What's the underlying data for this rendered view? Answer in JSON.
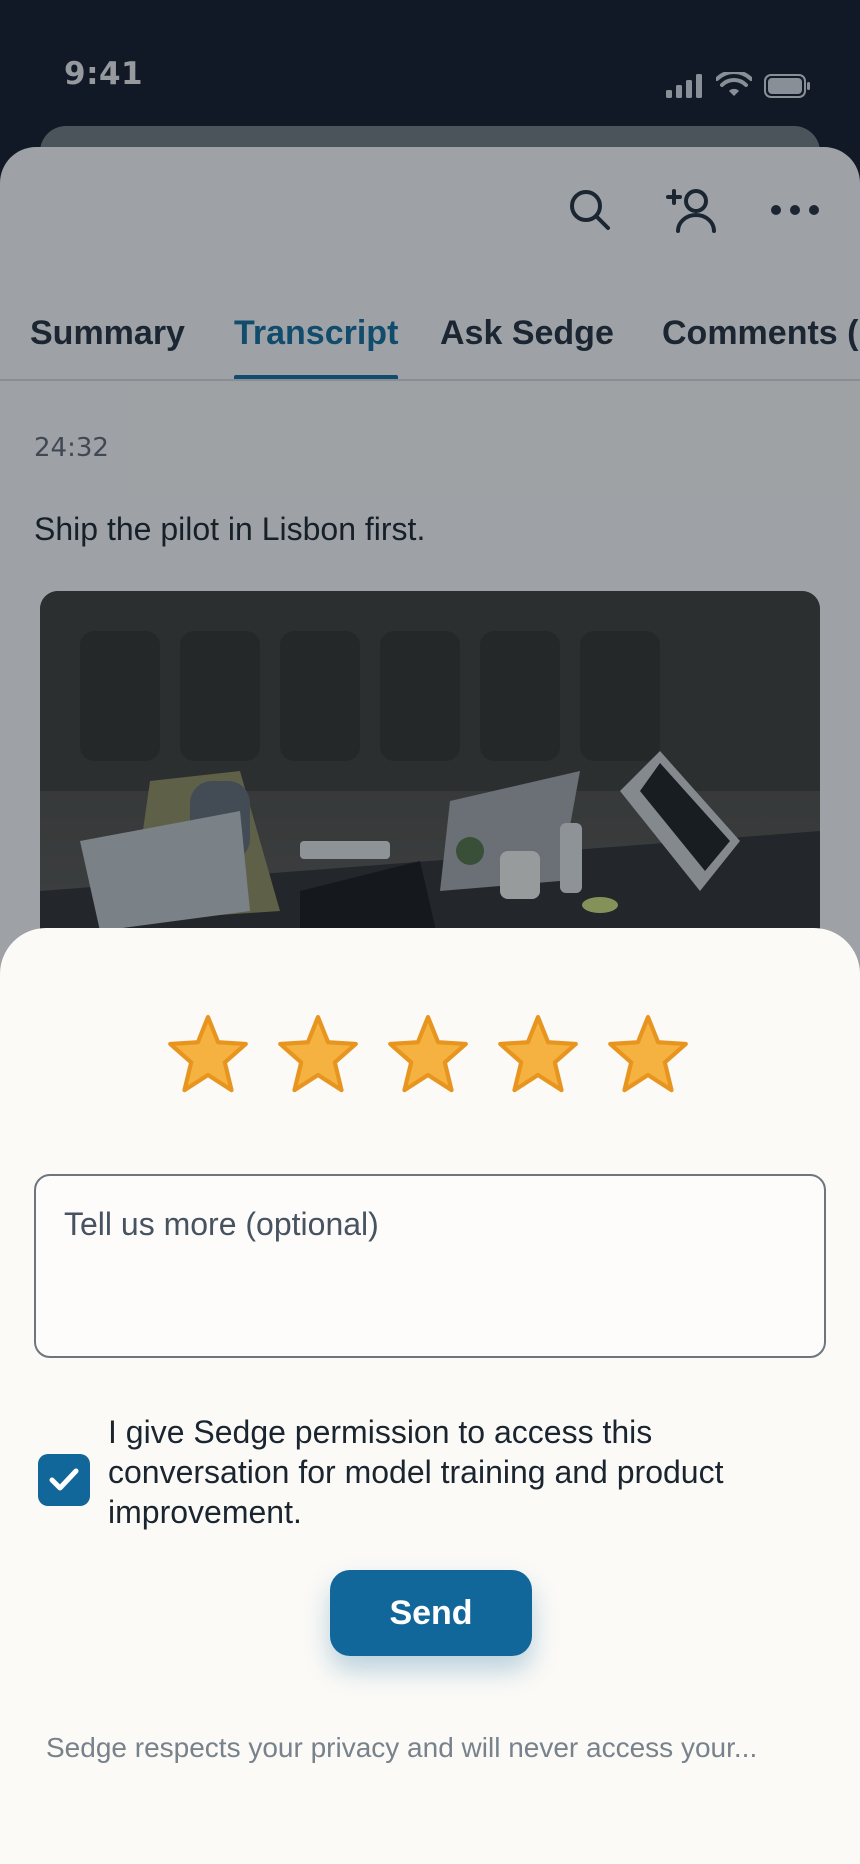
{
  "status_bar": {
    "time": "9:41"
  },
  "header": {
    "icons": [
      "search-icon",
      "add-person-icon",
      "more-icon"
    ]
  },
  "tabs": [
    {
      "label": "Summary"
    },
    {
      "label": "Transcript",
      "active": true
    },
    {
      "label": "Ask Sedge"
    },
    {
      "label": "Comments ("
    }
  ],
  "transcript": {
    "timestamp": "24:32",
    "text": "Ship the pilot in Lisbon first.",
    "image_alt": "meeting-room-photo"
  },
  "feedback": {
    "rating": 5,
    "max_rating": 5,
    "star_color": "#f5b240",
    "comment_placeholder": "Tell us more (optional)",
    "consent_checked": true,
    "consent_text": "I give Sedge permission to access this conversation for model training and product improvement.",
    "send_label": "Send",
    "privacy_note": "Sedge respects your privacy and will never access your..."
  },
  "colors": {
    "accent": "#12679a",
    "tab_active": "#0f6a9a"
  }
}
